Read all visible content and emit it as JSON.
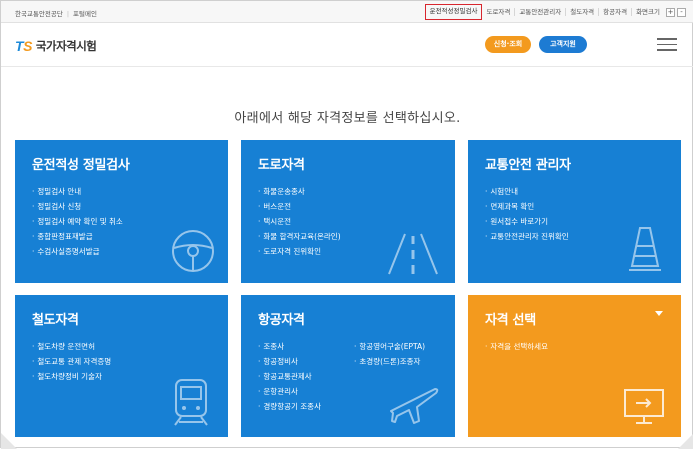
{
  "topbar": {
    "left_links": [
      "한국교통안전공단",
      "포털메인"
    ],
    "right_links": [
      "운전적성정밀검사",
      "도로자격",
      "교통안전관리자",
      "철도자격",
      "항공자격",
      "화면크기"
    ],
    "zoom_in": "+",
    "zoom_out": "-"
  },
  "header": {
    "logo_ts": "TS",
    "logo_text": "국가자격시험",
    "btn_apply": "신청·조회",
    "btn_support": "고객지원"
  },
  "prompt": "아래에서 해당 자격정보를 선택하십시오.",
  "cards": {
    "aptitude": {
      "title": "운전적성 정밀검사",
      "items": [
        "정밀검사 안내",
        "정밀검사 신청",
        "정밀검사 예약 확인 및 취소",
        "종합판정표재발급",
        "수검사실증명서발급"
      ]
    },
    "road": {
      "title": "도로자격",
      "items": [
        "화물운송종사",
        "버스운전",
        "택시운전",
        "화물 합격자교육(온라인)",
        "도로자격 진위확인"
      ]
    },
    "safety": {
      "title": "교통안전 관리자",
      "items": [
        "시험안내",
        "면제과목 확인",
        "원서접수 바로가기",
        "교통안전관리자 진위확인"
      ]
    },
    "rail": {
      "title": "철도자격",
      "items": [
        "철도차량 운전면허",
        "철도교통 관제 자격증명",
        "철도차량정비 기술자"
      ]
    },
    "aviation": {
      "title": "항공자격",
      "items_col1": [
        "조종사",
        "항공정비사",
        "항공교통관제사",
        "운항관리사",
        "경량항공기 조종사"
      ],
      "items_col2": [
        "항공영어구술(EPTA)",
        "초경량(드론)조종자"
      ]
    },
    "select": {
      "title": "자격 선택",
      "items": [
        "자격을 선택하세요"
      ]
    }
  },
  "colors": {
    "card_blue": "#1780d4",
    "card_orange": "#f39a1e",
    "active_outline": "#d8262e"
  }
}
